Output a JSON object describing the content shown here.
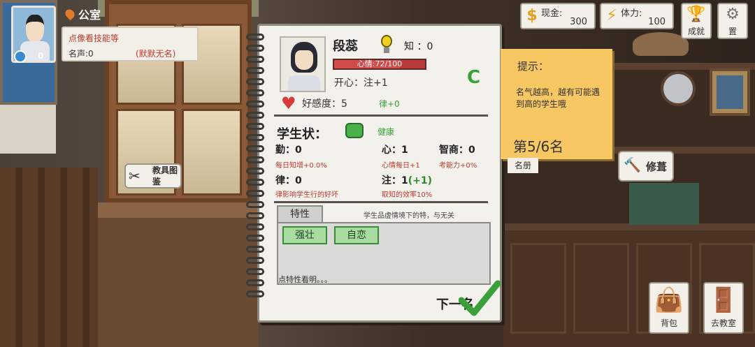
{
  "player": {
    "location": "公室",
    "badge_count": "0",
    "tip": "点像看技能等",
    "fame_label": "名声:0",
    "fame_title": "(默默无名)"
  },
  "status": {
    "cash_label": "现金:",
    "cash_value": "300",
    "stamina_label": "体力:",
    "stamina_value": "100",
    "achievements": "成就",
    "settings": "置"
  },
  "student": {
    "name": "段蕊",
    "know_label": "知 ：0",
    "mood_text": "心情:72/100",
    "mood_fraction": 0.72,
    "happy": "开心：注+1",
    "grade": "C",
    "favor": "好感度：5",
    "favor_bonus": "律+0",
    "status_title": "学生状：",
    "health": "健康",
    "stats": [
      {
        "label": "勤：0",
        "sub": "每日知增+0.0%"
      },
      {
        "label": "心：1",
        "sub": "心情每日+1"
      },
      {
        "label": "智商：0",
        "sub": "考能力+0%"
      },
      {
        "label": "律：0",
        "sub": "律影响学生行的好坏"
      },
      {
        "label": "注：1",
        "plus": "(+1)",
        "sub": "取知的效率10%"
      }
    ],
    "traits_tab": "特性",
    "traits_hint": "学生品虚情境下的特，与无关",
    "traits": [
      "强壮",
      "自恋"
    ],
    "trait_desc": "点特性看明。。。",
    "next": "下一名"
  },
  "tip_note": {
    "title": "提示：",
    "message": "名气越高，越有可能遇到高的学生哦",
    "rank": "第5/6名",
    "under": "名册"
  },
  "buttons": {
    "repair": "修葺",
    "tool": "教具图鉴",
    "bag": "背包",
    "classroom": "去教室"
  },
  "colors": {
    "accent_green": "#3aa03a",
    "mood_red": "#d24a4a",
    "sticky_yellow": "#f7c764"
  }
}
